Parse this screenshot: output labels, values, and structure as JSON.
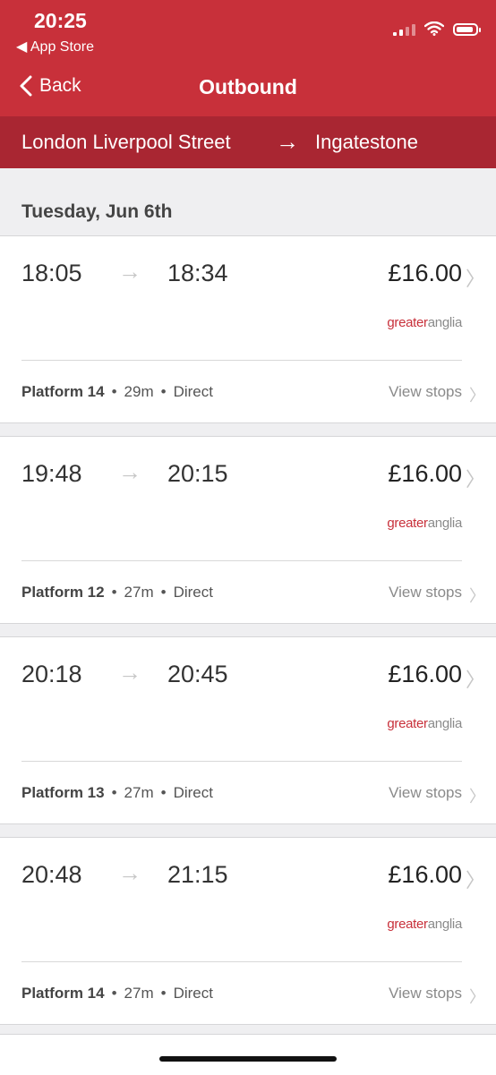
{
  "status_bar": {
    "time": "20:25",
    "back_app": "App Store"
  },
  "nav": {
    "back_label": "Back",
    "title": "Outbound"
  },
  "route": {
    "from": "London Liverpool Street",
    "arrow": "→",
    "to": "Ingatestone"
  },
  "date_heading": "Tuesday, Jun 6th",
  "journeys": [
    {
      "depart": "18:05",
      "arrive": "18:34",
      "price": "£16.00",
      "operator_a": "greater",
      "operator_b": "anglia",
      "platform": "Platform 14",
      "duration": "29m",
      "type": "Direct",
      "view_stops": "View stops"
    },
    {
      "depart": "19:48",
      "arrive": "20:15",
      "price": "£16.00",
      "operator_a": "greater",
      "operator_b": "anglia",
      "platform": "Platform 12",
      "duration": "27m",
      "type": "Direct",
      "view_stops": "View stops"
    },
    {
      "depart": "20:18",
      "arrive": "20:45",
      "price": "£16.00",
      "operator_a": "greater",
      "operator_b": "anglia",
      "platform": "Platform 13",
      "duration": "27m",
      "type": "Direct",
      "view_stops": "View stops"
    },
    {
      "depart": "20:48",
      "arrive": "21:15",
      "price": "£16.00",
      "operator_a": "greater",
      "operator_b": "anglia",
      "platform": "Platform 14",
      "duration": "27m",
      "type": "Direct",
      "view_stops": "View stops"
    }
  ],
  "colors": {
    "header": "#c8303a",
    "route_bar": "#a92632",
    "background": "#efeff1",
    "operator_red": "#c8303a"
  },
  "icons": {
    "back": "chevron-left-icon",
    "journey_arrow": "arrow-right-icon",
    "row_chevron": "chevron-right-icon"
  }
}
